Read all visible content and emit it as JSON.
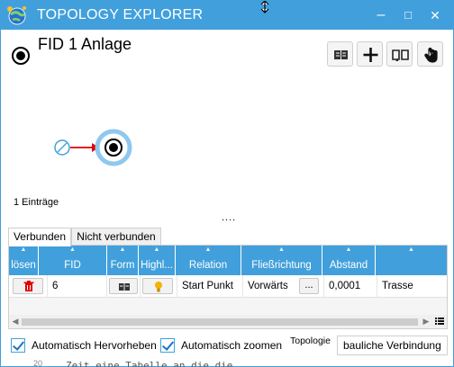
{
  "window": {
    "title": "TOPOLOGY EXPLORER",
    "minimize": "–",
    "maximize": "□",
    "close": "✕"
  },
  "header": {
    "title": "FID 1 Anlage"
  },
  "toolbar": {
    "icons": [
      "book-icon",
      "plus-icon",
      "open-book-icon",
      "hand-pointer-icon"
    ]
  },
  "canvas": {
    "entries_count": "1 Einträge",
    "splitter": "...."
  },
  "tabs": [
    "Verbunden",
    "Nicht verbunden"
  ],
  "table": {
    "columns": [
      "lösen",
      "FID",
      "Form",
      "Highl...",
      "Relation",
      "Fließrichtung",
      "Abstand",
      ""
    ],
    "rows": [
      {
        "loesen": "delete-icon",
        "fid": "6",
        "form": "book-icon",
        "highlight": "bulb-icon",
        "relation": "Start Punkt",
        "fliessrichtung": "Vorwärts",
        "more": "...",
        "abstand": "0,0001",
        "typ": "Trasse"
      }
    ]
  },
  "footer": {
    "auto_highlight": "Automatisch Hervorheben",
    "auto_zoom": "Automatisch zoomen",
    "topologie_label": "Topologie",
    "topologie_value": "bauliche Verbindung"
  },
  "background": {
    "line_no": "20",
    "code": "Zeit eine Tabelle an die die"
  },
  "colors": {
    "accent": "#41a0dc",
    "arrow": "#e00000",
    "delete": "#e00000",
    "bulb": "#f2b400"
  }
}
